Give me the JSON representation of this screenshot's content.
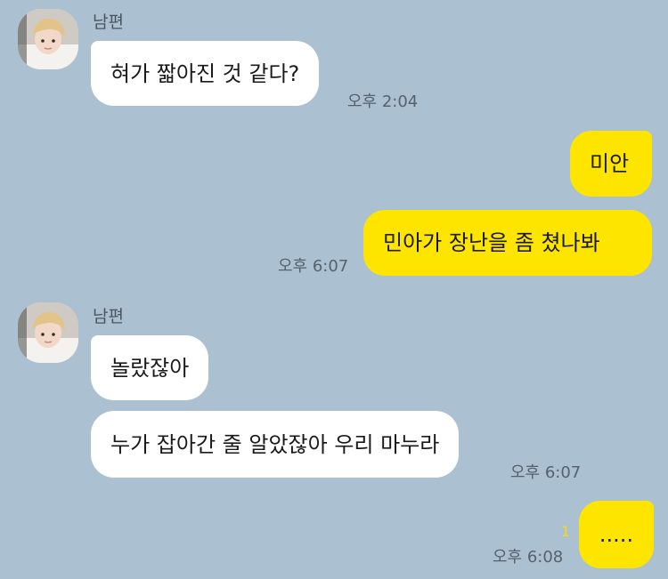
{
  "messages": {
    "m1": {
      "sender": "남편",
      "text": "혀가 짧아진 것 같다?",
      "time": "오후 2:04"
    },
    "m2": {
      "text": "미안"
    },
    "m3": {
      "text": "민아가 장난을 좀 쳤나봐",
      "time": "오후 6:07"
    },
    "m4": {
      "sender": "남편",
      "text": "놀랐잖아"
    },
    "m5": {
      "text": "누가 잡아간 줄 알았잖아 우리 마누라",
      "time": "오후 6:07"
    },
    "m6": {
      "text": ".....",
      "time": "오후 6:08",
      "unread": "1"
    }
  },
  "colors": {
    "background": "#abc1d1",
    "incoming_bubble": "#ffffff",
    "outgoing_bubble": "#fee500",
    "unread": "#f4d81a"
  },
  "icons": {
    "avatar": "profile-photo"
  }
}
